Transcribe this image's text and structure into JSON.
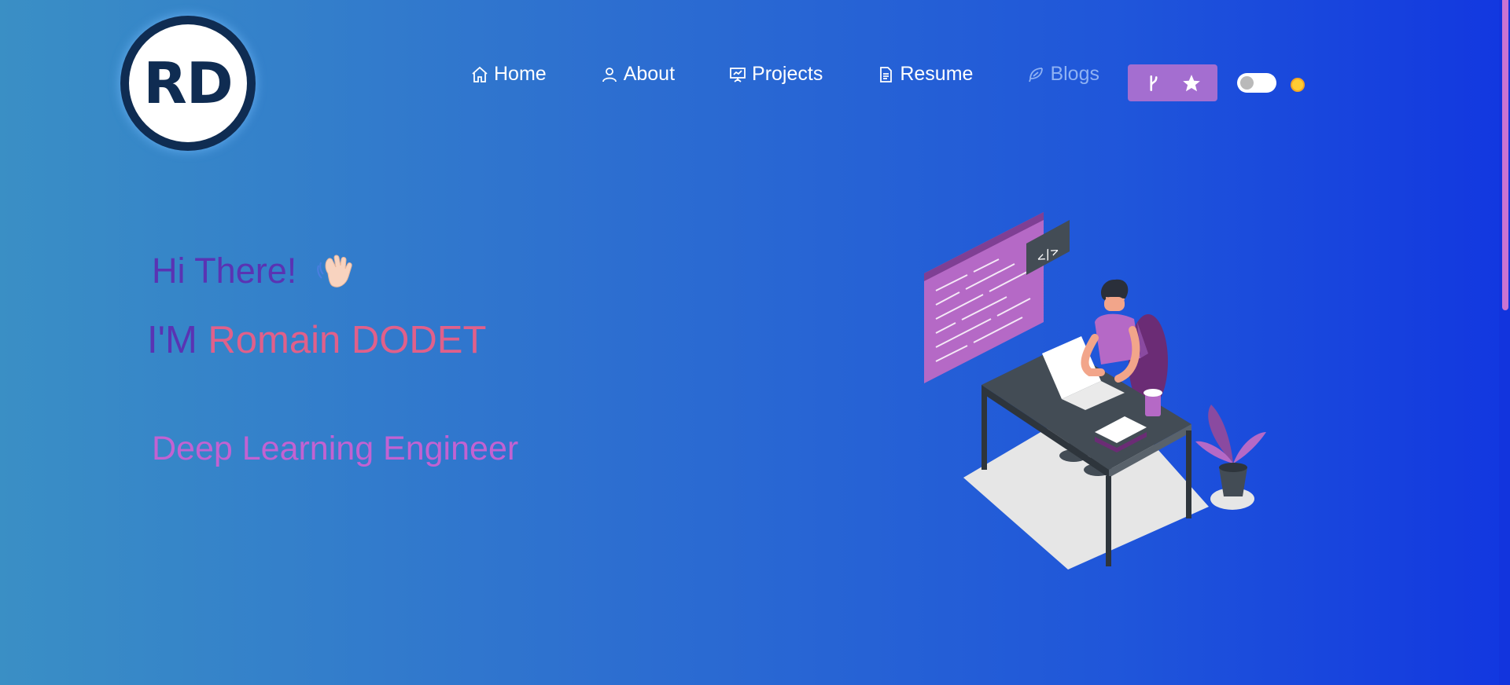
{
  "logo": {
    "text": "RD"
  },
  "nav": {
    "items": [
      {
        "label": "Home",
        "icon": "home-icon"
      },
      {
        "label": "About",
        "icon": "user-icon"
      },
      {
        "label": "Projects",
        "icon": "presentation-icon"
      },
      {
        "label": "Resume",
        "icon": "document-icon"
      },
      {
        "label": "Blogs",
        "icon": "feather-icon"
      }
    ],
    "github_button": {
      "icons": [
        "fork-icon",
        "star-icon"
      ]
    },
    "theme_toggle": {
      "state": "off",
      "icon": "sun-icon"
    }
  },
  "hero": {
    "greeting": "Hi There!",
    "greeting_icon": "waving-hand-icon",
    "intro_prefix": "I'M",
    "name": "Romain DODET",
    "role": "Deep Learning Engineer"
  },
  "colors": {
    "accent_purple": "#5a33b3",
    "name_pink": "#e0608a",
    "role_violet": "#c262d2",
    "button_purple": "#a46ed0"
  }
}
